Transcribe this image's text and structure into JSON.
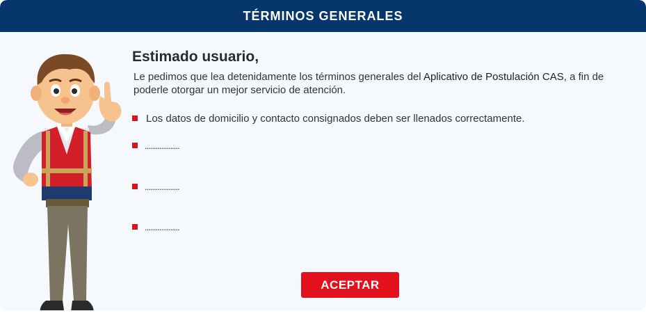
{
  "modal": {
    "title": "TÉRMINOS GENERALES",
    "greeting": "Estimado usuario,",
    "intro_before": "Le pedimos que lea detenidamente los términos generales del ",
    "intro_highlight": "Aplicativo de Postulación CAS",
    "intro_after": ", a fin de poderle otorgar un mejor servicio de atención.",
    "terms": [
      "Los datos de domicilio y contacto consignados deben ser llenados correctamente.",
      "...................",
      "...................",
      "..................."
    ],
    "accept_label": "ACEPTAR"
  },
  "colors": {
    "header_bg": "#06366b",
    "body_bg": "#f5f9fd",
    "bullet": "#d7141d",
    "button_bg": "#e3111b"
  },
  "icons": {
    "character": "cartoon-man-pointing-up-illustration",
    "bullet": "red-square-bullet"
  }
}
